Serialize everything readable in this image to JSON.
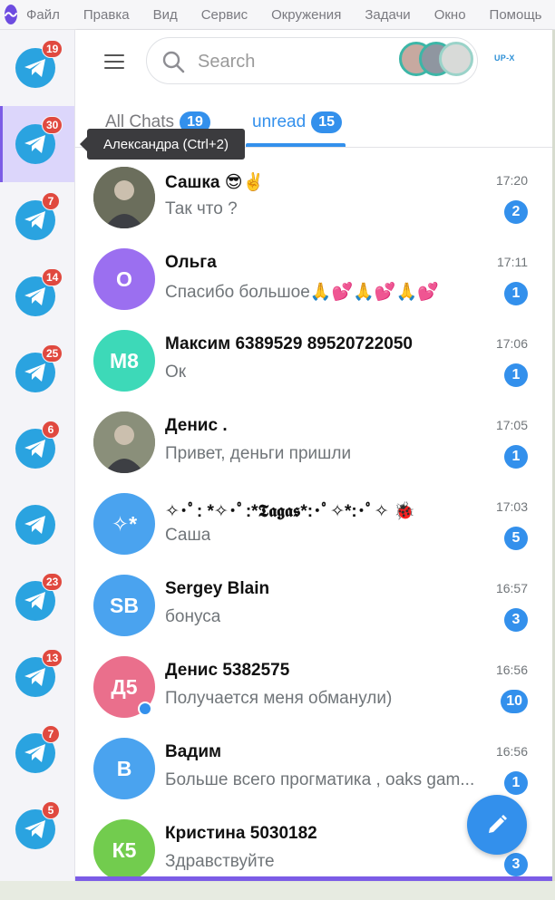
{
  "menu": {
    "items": [
      "Файл",
      "Правка",
      "Вид",
      "Сервис",
      "Окружения",
      "Задачи",
      "Окно",
      "Помощь"
    ]
  },
  "rail": {
    "items": [
      {
        "badge": "19",
        "active": false
      },
      {
        "badge": "30",
        "active": true
      },
      {
        "badge": "7",
        "active": false
      },
      {
        "badge": "14",
        "active": false
      },
      {
        "badge": "25",
        "active": false
      },
      {
        "badge": "6",
        "active": false
      },
      {
        "badge": "",
        "active": false
      },
      {
        "badge": "23",
        "active": false
      },
      {
        "badge": "13",
        "active": false
      },
      {
        "badge": "7",
        "active": false
      },
      {
        "badge": "5",
        "active": false
      }
    ]
  },
  "tooltip": {
    "text": "Александра (Ctrl+2)"
  },
  "search": {
    "placeholder": "Search"
  },
  "brand": {
    "text": "UP-X"
  },
  "tabs": {
    "all": {
      "label": "All Chats",
      "count": "19"
    },
    "unread": {
      "label": "unread",
      "count": "15"
    }
  },
  "chats": [
    {
      "name": "Сашка 😎✌️",
      "preview": "Так что ?",
      "time": "17:20",
      "unread": "2",
      "avatar_text": "",
      "avatar_color": "#6b6e5c",
      "photo": true
    },
    {
      "name": "Ольга",
      "preview": "Спасибо большое🙏💕🙏💕🙏💕",
      "time": "17:11",
      "unread": "1",
      "avatar_text": "О",
      "avatar_color": "#9b6ff0",
      "photo": false
    },
    {
      "name": "Максим 6389529 89520722050",
      "preview": "Ок",
      "time": "17:06",
      "unread": "1",
      "avatar_text": "М8",
      "avatar_color": "#3dd9b8",
      "photo": false
    },
    {
      "name": "Денис .",
      "preview": "Привет, деньги пришли",
      "time": "17:05",
      "unread": "1",
      "avatar_text": "",
      "avatar_color": "#8a8f7a",
      "photo": true
    },
    {
      "name": "✧･ﾟ: *✧･ﾟ:*𝕿𝖆𝖌𝖆𝖘*:･ﾟ✧*:･ﾟ✧ 🐞",
      "preview": "Саша",
      "time": "17:03",
      "unread": "5",
      "avatar_text": "✧*",
      "avatar_color": "#4aa3ef",
      "photo": false
    },
    {
      "name": "Sergey Blain",
      "preview": "бонуса",
      "time": "16:57",
      "unread": "3",
      "avatar_text": "SB",
      "avatar_color": "#4aa3ef",
      "photo": false
    },
    {
      "name": "Денис 5382575",
      "preview": "Получается меня обманули)",
      "time": "16:56",
      "unread": "10",
      "avatar_text": "Д5",
      "avatar_color": "#ea6f8c",
      "photo": false,
      "online": true
    },
    {
      "name": "Вадим",
      "preview": "Больше всего прогматика , oaks gam...",
      "time": "16:56",
      "unread": "1",
      "avatar_text": "В",
      "avatar_color": "#4aa3ef",
      "photo": false
    },
    {
      "name": "Кристина 5030182",
      "preview": "Здравствуйте",
      "time": "",
      "unread": "3",
      "avatar_text": "К5",
      "avatar_color": "#72cc4e",
      "photo": false
    }
  ]
}
